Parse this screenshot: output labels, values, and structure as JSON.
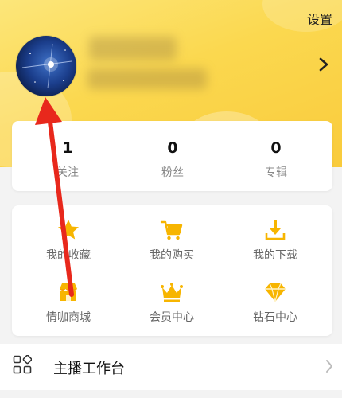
{
  "header": {
    "settings_label": "设置"
  },
  "profile": {
    "avatar_icon": "starry-sky-avatar",
    "chevron_icon": "chevron-right-icon"
  },
  "stats": [
    {
      "value": "1",
      "label": "关注"
    },
    {
      "value": "0",
      "label": "粉丝"
    },
    {
      "value": "0",
      "label": "专辑"
    }
  ],
  "features": [
    {
      "label": "我的收藏",
      "icon": "star-icon"
    },
    {
      "label": "我的购买",
      "icon": "cart-icon"
    },
    {
      "label": "我的下载",
      "icon": "download-icon"
    },
    {
      "label": "情咖商城",
      "icon": "shop-icon"
    },
    {
      "label": "会员中心",
      "icon": "crown-icon"
    },
    {
      "label": "钻石中心",
      "icon": "diamond-icon"
    }
  ],
  "workbench": {
    "label": "主播工作台",
    "icon": "grid-apps-icon"
  },
  "colors": {
    "accent": "#f7b500",
    "header": "#fbd84f",
    "annotation_arrow": "#e8281c"
  }
}
